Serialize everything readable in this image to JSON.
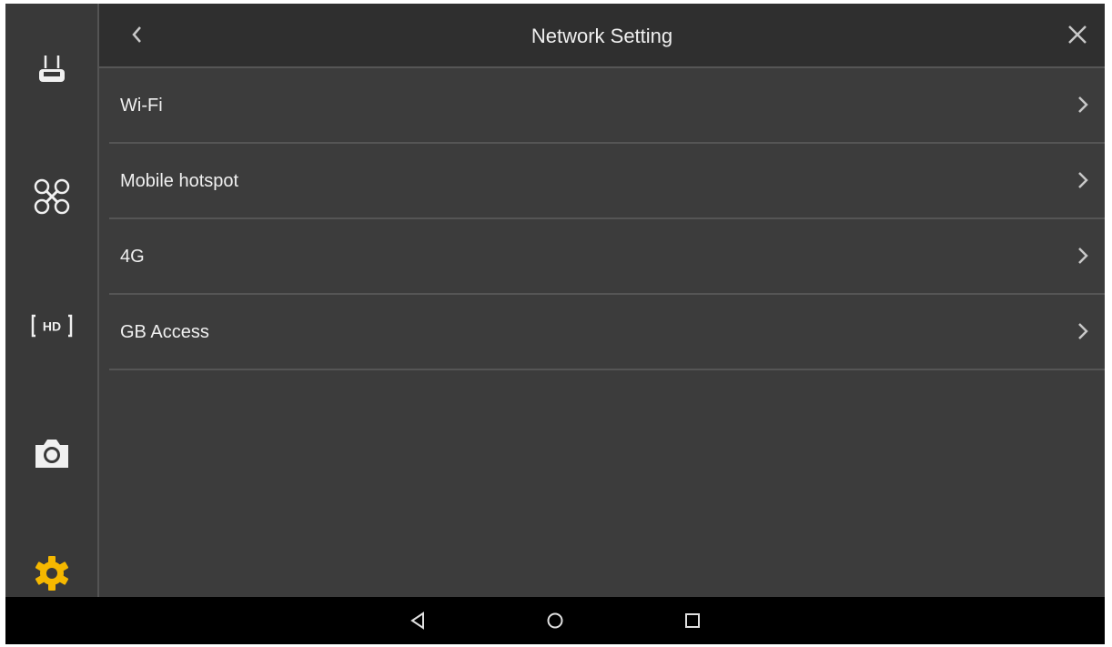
{
  "header": {
    "title": "Network Setting"
  },
  "sidebar": {
    "items": [
      {
        "icon": "remote-controller-icon",
        "active": false
      },
      {
        "icon": "drone-icon",
        "active": false
      },
      {
        "icon": "hd-icon",
        "label": "HD",
        "active": false
      },
      {
        "icon": "camera-icon",
        "active": false
      },
      {
        "icon": "gear-icon",
        "active": true
      }
    ]
  },
  "list": {
    "items": [
      {
        "label": "Wi-Fi"
      },
      {
        "label": "Mobile hotspot"
      },
      {
        "label": "4G"
      },
      {
        "label": "GB Access"
      }
    ]
  },
  "colors": {
    "accent": "#f5b800",
    "background": "#3c3c3c",
    "header": "#2f2f2f",
    "text": "#f0f0f0",
    "navbar": "#000000"
  }
}
